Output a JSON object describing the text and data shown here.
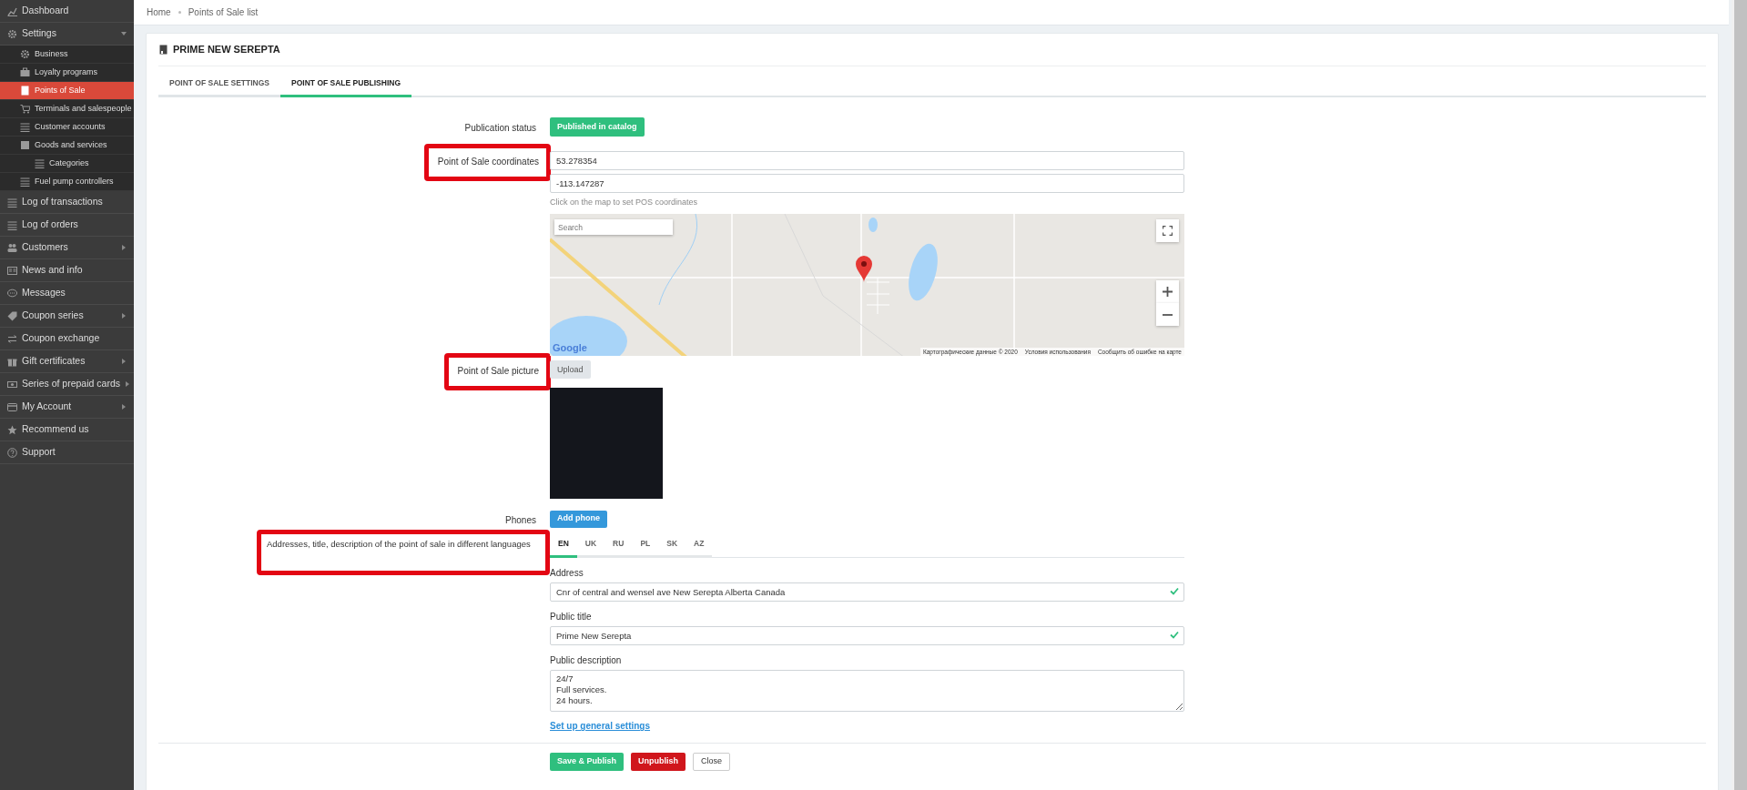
{
  "sidebar": {
    "items": [
      {
        "label": "Dashboard",
        "selected": false
      },
      {
        "label": "Settings",
        "selected": false,
        "expanded": true,
        "children": [
          {
            "label": "Business",
            "selected": false
          },
          {
            "label": "Loyalty programs",
            "selected": false
          },
          {
            "label": "Points of Sale",
            "selected": true
          },
          {
            "label": "Terminals and salespeople",
            "selected": false
          },
          {
            "label": "Customer accounts",
            "selected": false
          },
          {
            "label": "Goods and services",
            "selected": false,
            "children": [
              {
                "label": "Categories",
                "selected": false
              }
            ]
          },
          {
            "label": "Fuel pump controllers",
            "selected": false
          }
        ]
      },
      {
        "label": "Log of transactions",
        "selected": false
      },
      {
        "label": "Log of orders",
        "selected": false
      },
      {
        "label": "Customers",
        "selected": false,
        "expanded": false
      },
      {
        "label": "News and info",
        "selected": false
      },
      {
        "label": "Messages",
        "selected": false
      },
      {
        "label": "Coupon series",
        "selected": false,
        "expanded": false
      },
      {
        "label": "Coupon exchange",
        "selected": false
      },
      {
        "label": "Gift certificates",
        "selected": false,
        "expanded": false
      },
      {
        "label": "Series of prepaid cards",
        "selected": false,
        "expanded": false
      },
      {
        "label": "My Account",
        "selected": false,
        "expanded": false
      },
      {
        "label": "Recommend us",
        "selected": false
      },
      {
        "label": "Support",
        "selected": false
      }
    ]
  },
  "breadcrumb": [
    "Home",
    "Points of Sale list"
  ],
  "card": {
    "title": "PRIME NEW SEREPTA",
    "tabs": [
      {
        "label": "POINT OF SALE SETTINGS",
        "selected": false
      },
      {
        "label": "POINT OF SALE PUBLISHING",
        "selected": true
      }
    ],
    "publication_status": {
      "label": "Publication status",
      "highlighted": false,
      "status": "Published in catalog"
    },
    "coordinates": {
      "label": "Point of Sale coordinates",
      "highlighted": true,
      "latitude": "53.278354",
      "longitude": "-113.147287",
      "help": "Click on the map to set POS coordinates"
    },
    "map": {
      "search_placeholder": "Search",
      "logo": "Google",
      "attribution": [
        "Картографические данные © 2020",
        "Условия использования",
        "Сообщить об ошибке на карте"
      ]
    },
    "picture": {
      "label": "Point of Sale picture",
      "highlighted": true,
      "upload": "Upload"
    },
    "phones": {
      "label": "Phones",
      "highlighted": false,
      "button": "Add phone"
    },
    "languages": {
      "label": "Addresses, title, description of the point of sale in different languages",
      "highlighted": true,
      "tabs": [
        {
          "label": "EN",
          "selected": true
        },
        {
          "label": "UK",
          "selected": false
        },
        {
          "label": "RU",
          "selected": false
        },
        {
          "label": "PL",
          "selected": false
        },
        {
          "label": "SK",
          "selected": false
        },
        {
          "label": "AZ",
          "selected": false
        }
      ]
    },
    "fields": [
      {
        "kind": "input",
        "label": "Address",
        "value": "Cnr of central and wensel ave New Serepta Alberta Canada",
        "valid": true
      },
      {
        "kind": "input",
        "label": "Public title",
        "value": "Prime New Serepta",
        "valid": true
      },
      {
        "kind": "textarea",
        "label": "Public description",
        "value": "24/7\nFull services.\n24 hours.",
        "valid": false
      }
    ],
    "link": "Set up general settings",
    "buttons": [
      {
        "label": "Save & Publish",
        "kind": "success"
      },
      {
        "label": "Unpublish",
        "kind": "danger"
      },
      {
        "label": "Close",
        "kind": "plain"
      }
    ]
  }
}
